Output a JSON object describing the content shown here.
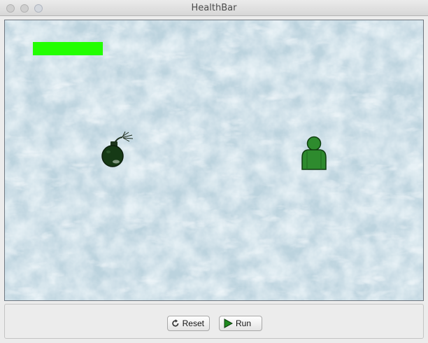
{
  "window": {
    "title": "HealthBar"
  },
  "world": {
    "health_bar": {
      "level_percent": 100,
      "color": "#22ff00"
    },
    "actors": [
      {
        "name": "bomb",
        "icon": "bomb-icon",
        "color": "#163a16"
      },
      {
        "name": "player",
        "icon": "person-icon",
        "color": "#2e8b2e"
      }
    ],
    "background_color": "#c9dde6"
  },
  "controls": {
    "reset_label": "Reset",
    "run_label": "Run"
  }
}
